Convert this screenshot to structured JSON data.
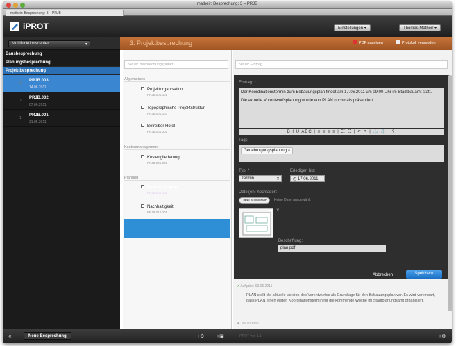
{
  "window": {
    "title": "matheir: Besprechung: 3 – PRJB",
    "tab": "matheir: Besprechung: 3 – PRJB"
  },
  "app": {
    "name": "iPROT",
    "settings": "Einstellungen",
    "user": "Thomas Matheir"
  },
  "sidebar": {
    "dropdown": "Multifunktionscenter",
    "sections": [
      "Bausbesprechung",
      "Planungsbesprechung",
      "Projektbesprechung"
    ],
    "items": [
      {
        "number": "3",
        "title": "PRJB.003",
        "date": "14.06.2011"
      },
      {
        "number": "2",
        "title": "PRJB.002",
        "date": "07.06.2011"
      },
      {
        "number": "1",
        "title": "PRJB.001",
        "date": "31.05.2011"
      }
    ]
  },
  "footer": {
    "new_meeting": "Neue Besprechung",
    "version": "iPROT ver. 1.1"
  },
  "content": {
    "title": "3. Projektbesprechung",
    "pdf": "PDF anzeigen",
    "send": "Protokoll versenden",
    "new_point": "Neuer Besprechungspunkt...",
    "groups": [
      {
        "label": "Allgemeines",
        "items": [
          {
            "title": "Projektorganisation",
            "code": "PRJB.001.001"
          },
          {
            "title": "Topographische Projektstruktur",
            "code": "PRJB.001.003"
          },
          {
            "title": "Betreiber Hotel",
            "code": "PRJB.001.002"
          }
        ]
      },
      {
        "label": "Kostenmanagement",
        "items": [
          {
            "title": "Kostengliederung",
            "code": "PRJB.001.002"
          }
        ]
      },
      {
        "label": "Planung",
        "items": [
          {
            "title": "Bebauungsplan",
            "code": "PRJB.002.001"
          },
          {
            "title": "Nachhaltigkeit",
            "code": "PRJB.010.001"
          }
        ]
      }
    ]
  },
  "editor": {
    "new_entry": "Neuer Eintrag...",
    "entry_label": "Eintrag: *",
    "entry_text1": "Der Koordinationstermin zum Bebauungsplan findet am 17.06.2011 um 09:00 Uhr im Stadtbauamt statt.",
    "entry_text2": "Die aktuelle Vorentwurfsplanung wurde von PLAN nochmals präsentiert.",
    "toolbar": "B  I  U  ABC  |  ≡  ≡  ≡  ≡  |  ☷  ☷  |  ↶  ↷  |  ⚓  ⚓  |  ?",
    "tags_label": "Tags:",
    "tag": "Genehmigungsplanung",
    "type_label": "Typ: *",
    "type_value": "Termin",
    "due_label": "Erledigen bis:",
    "due_value": "17.06.2011",
    "upload_label": "Datei(en) hochladen:",
    "choose": "Datei auswählen",
    "nofile": "Keine Datei ausgewählt",
    "caption_label": "Beschriftung:",
    "caption_value": "plan.pdf",
    "cancel": "Abbrechen",
    "save": "Speichern"
  },
  "task": {
    "header": "Aufgabe: 03.06.2011",
    "text": "PLAN stellt die aktuelle Version des Vorentwurfes als Grundlage für den Bebauungsplan vor. Es wird vereinbart, dass PLAN einen ersten Koordinationstermin für die kommende Woche im Stadtplanungsamt organisiert.",
    "next": "Neuer Plan"
  }
}
